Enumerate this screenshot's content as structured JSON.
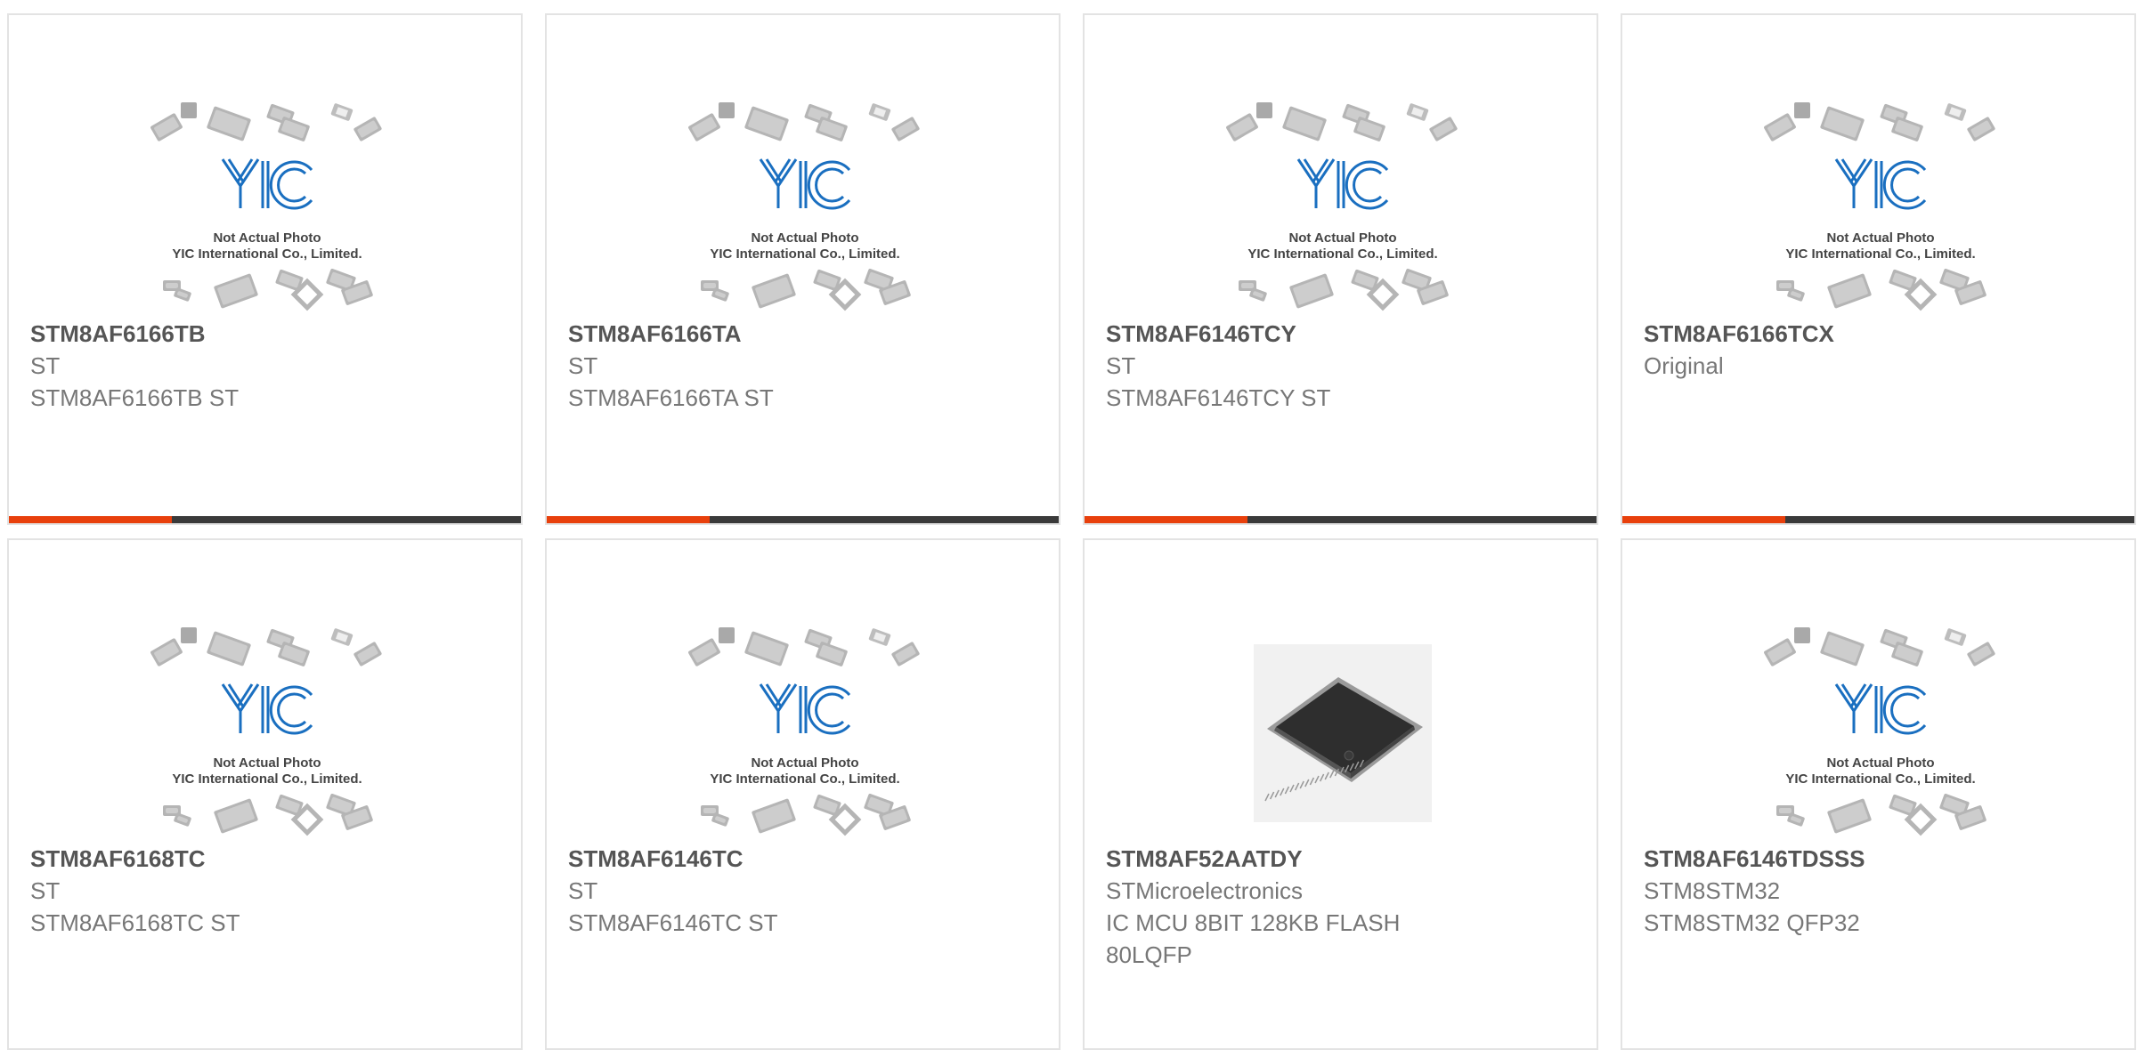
{
  "products": [
    {
      "part": "STM8AF6166TB",
      "maker": "ST",
      "desc": "STM8AF6166TB ST",
      "image": "placeholder",
      "placeholder_line1": "Not Actual Photo",
      "placeholder_line2": "YIC International Co., Limited."
    },
    {
      "part": "STM8AF6166TA",
      "maker": "ST",
      "desc": "STM8AF6166TA ST",
      "image": "placeholder",
      "placeholder_line1": "Not Actual Photo",
      "placeholder_line2": "YIC International Co., Limited."
    },
    {
      "part": "STM8AF6146TCY",
      "maker": "ST",
      "desc": "STM8AF6146TCY ST",
      "image": "placeholder",
      "placeholder_line1": "Not Actual Photo",
      "placeholder_line2": "YIC International Co., Limited."
    },
    {
      "part": "STM8AF6166TCX",
      "maker": "Original",
      "desc": "",
      "image": "placeholder",
      "placeholder_line1": "Not Actual Photo",
      "placeholder_line2": "YIC International Co., Limited."
    },
    {
      "part": "STM8AF6168TC",
      "maker": "ST",
      "desc": "STM8AF6168TC ST",
      "image": "placeholder",
      "placeholder_line1": "Not Actual Photo",
      "placeholder_line2": "YIC International Co., Limited."
    },
    {
      "part": "STM8AF6146TC",
      "maker": "ST",
      "desc": "STM8AF6146TC ST",
      "image": "placeholder",
      "placeholder_line1": "Not Actual Photo",
      "placeholder_line2": "YIC International Co., Limited."
    },
    {
      "part": "STM8AF52AATDY",
      "maker": "STMicroelectronics",
      "desc": "IC MCU 8BIT 128KB FLASH\n80LQFP",
      "image": "chip"
    },
    {
      "part": "STM8AF6146TDSSS",
      "maker": "STM8STM32",
      "desc": "STM8STM32 QFP32",
      "image": "placeholder",
      "placeholder_line1": "Not Actual Photo",
      "placeholder_line2": "YIC International Co., Limited."
    }
  ],
  "brand_logo_text": "YIC",
  "colors": {
    "accent": "#e8400c",
    "bar": "#3a3a3a",
    "logo": "#1a6fc0"
  }
}
